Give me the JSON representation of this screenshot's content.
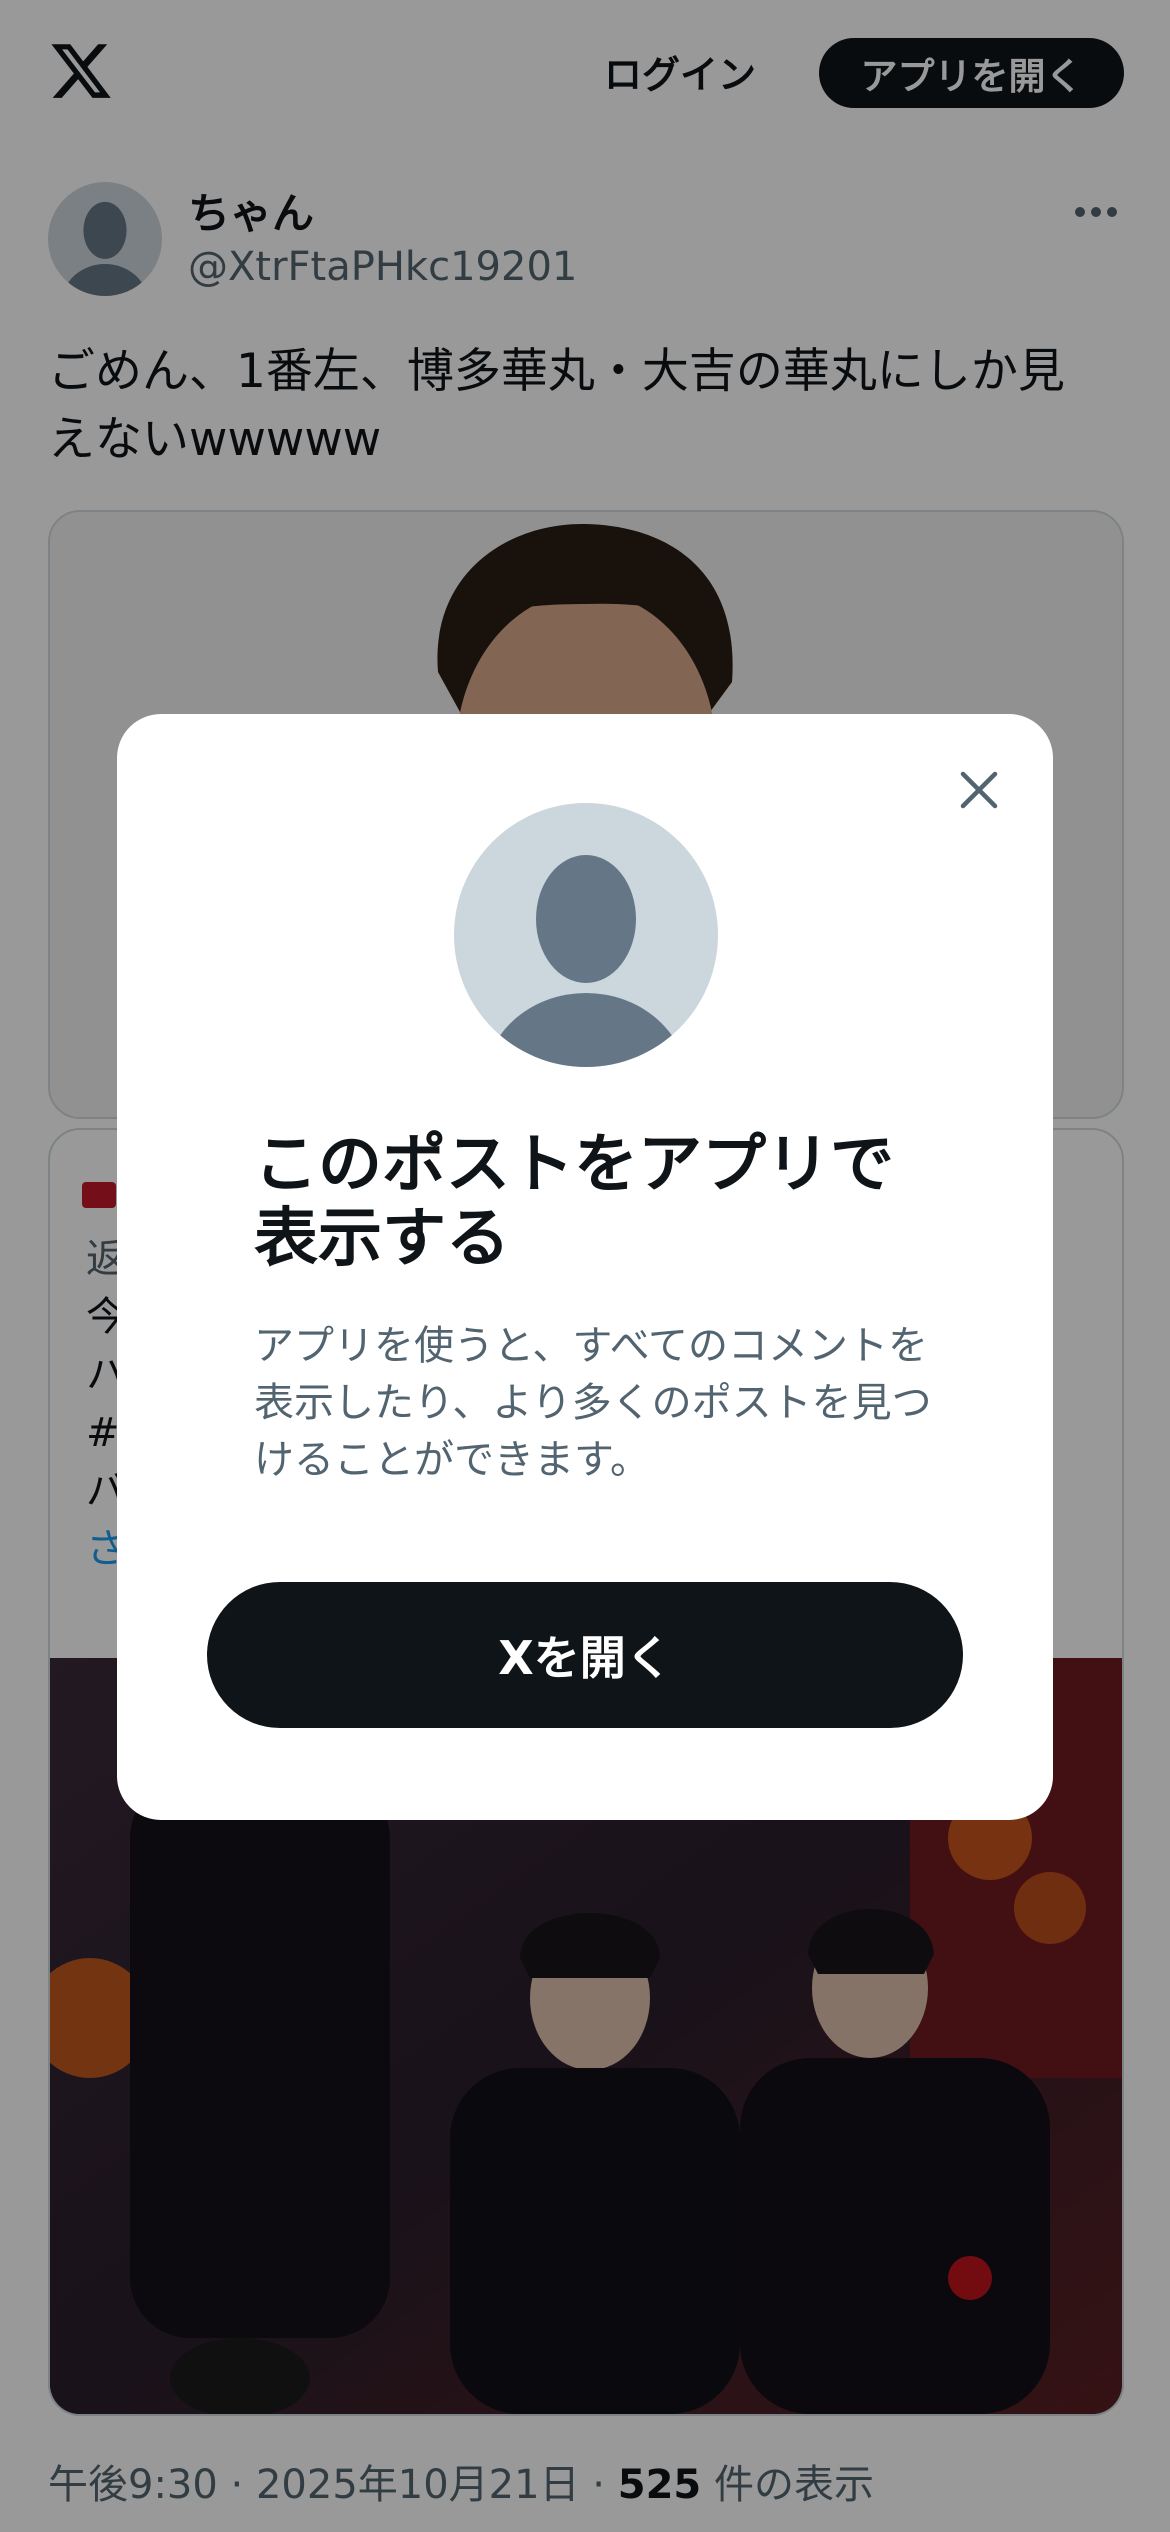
{
  "header": {
    "logo_icon": "x-logo-icon",
    "login_label": "ログイン",
    "open_app_label": "アプリを開く"
  },
  "post": {
    "display_name": "ちゃん",
    "handle": "@XtrFtaPHkc19201",
    "more_icon": "more-horizontal-icon",
    "text_line1": "ごめん、1番左、博多華丸・大吉の華丸にしか見",
    "text_line2": "えないwwwww"
  },
  "quote": {
    "line1": "返",
    "line2": "今",
    "line3": "ハ",
    "line4": "#",
    "line5": "バ",
    "line6": "さ"
  },
  "footer": {
    "time": "午後9:30",
    "sep1": " · ",
    "date": "2025年10月21日",
    "sep2": " · ",
    "views_count": "525",
    "views_label": " 件の表示"
  },
  "modal": {
    "close_icon": "close-icon",
    "title": "このポストをアプリで表示する",
    "description": "アプリを使うと、すべてのコメントを表示したり、より多くのポストを見つけることができます。",
    "button_label": "Xを開く"
  },
  "colors": {
    "text_primary": "#0f1419",
    "text_secondary": "#536471",
    "button_bg": "#0f1419",
    "avatar_bg": "#ccd6dd",
    "avatar_fg": "#657786",
    "link": "#1d9bf0"
  }
}
